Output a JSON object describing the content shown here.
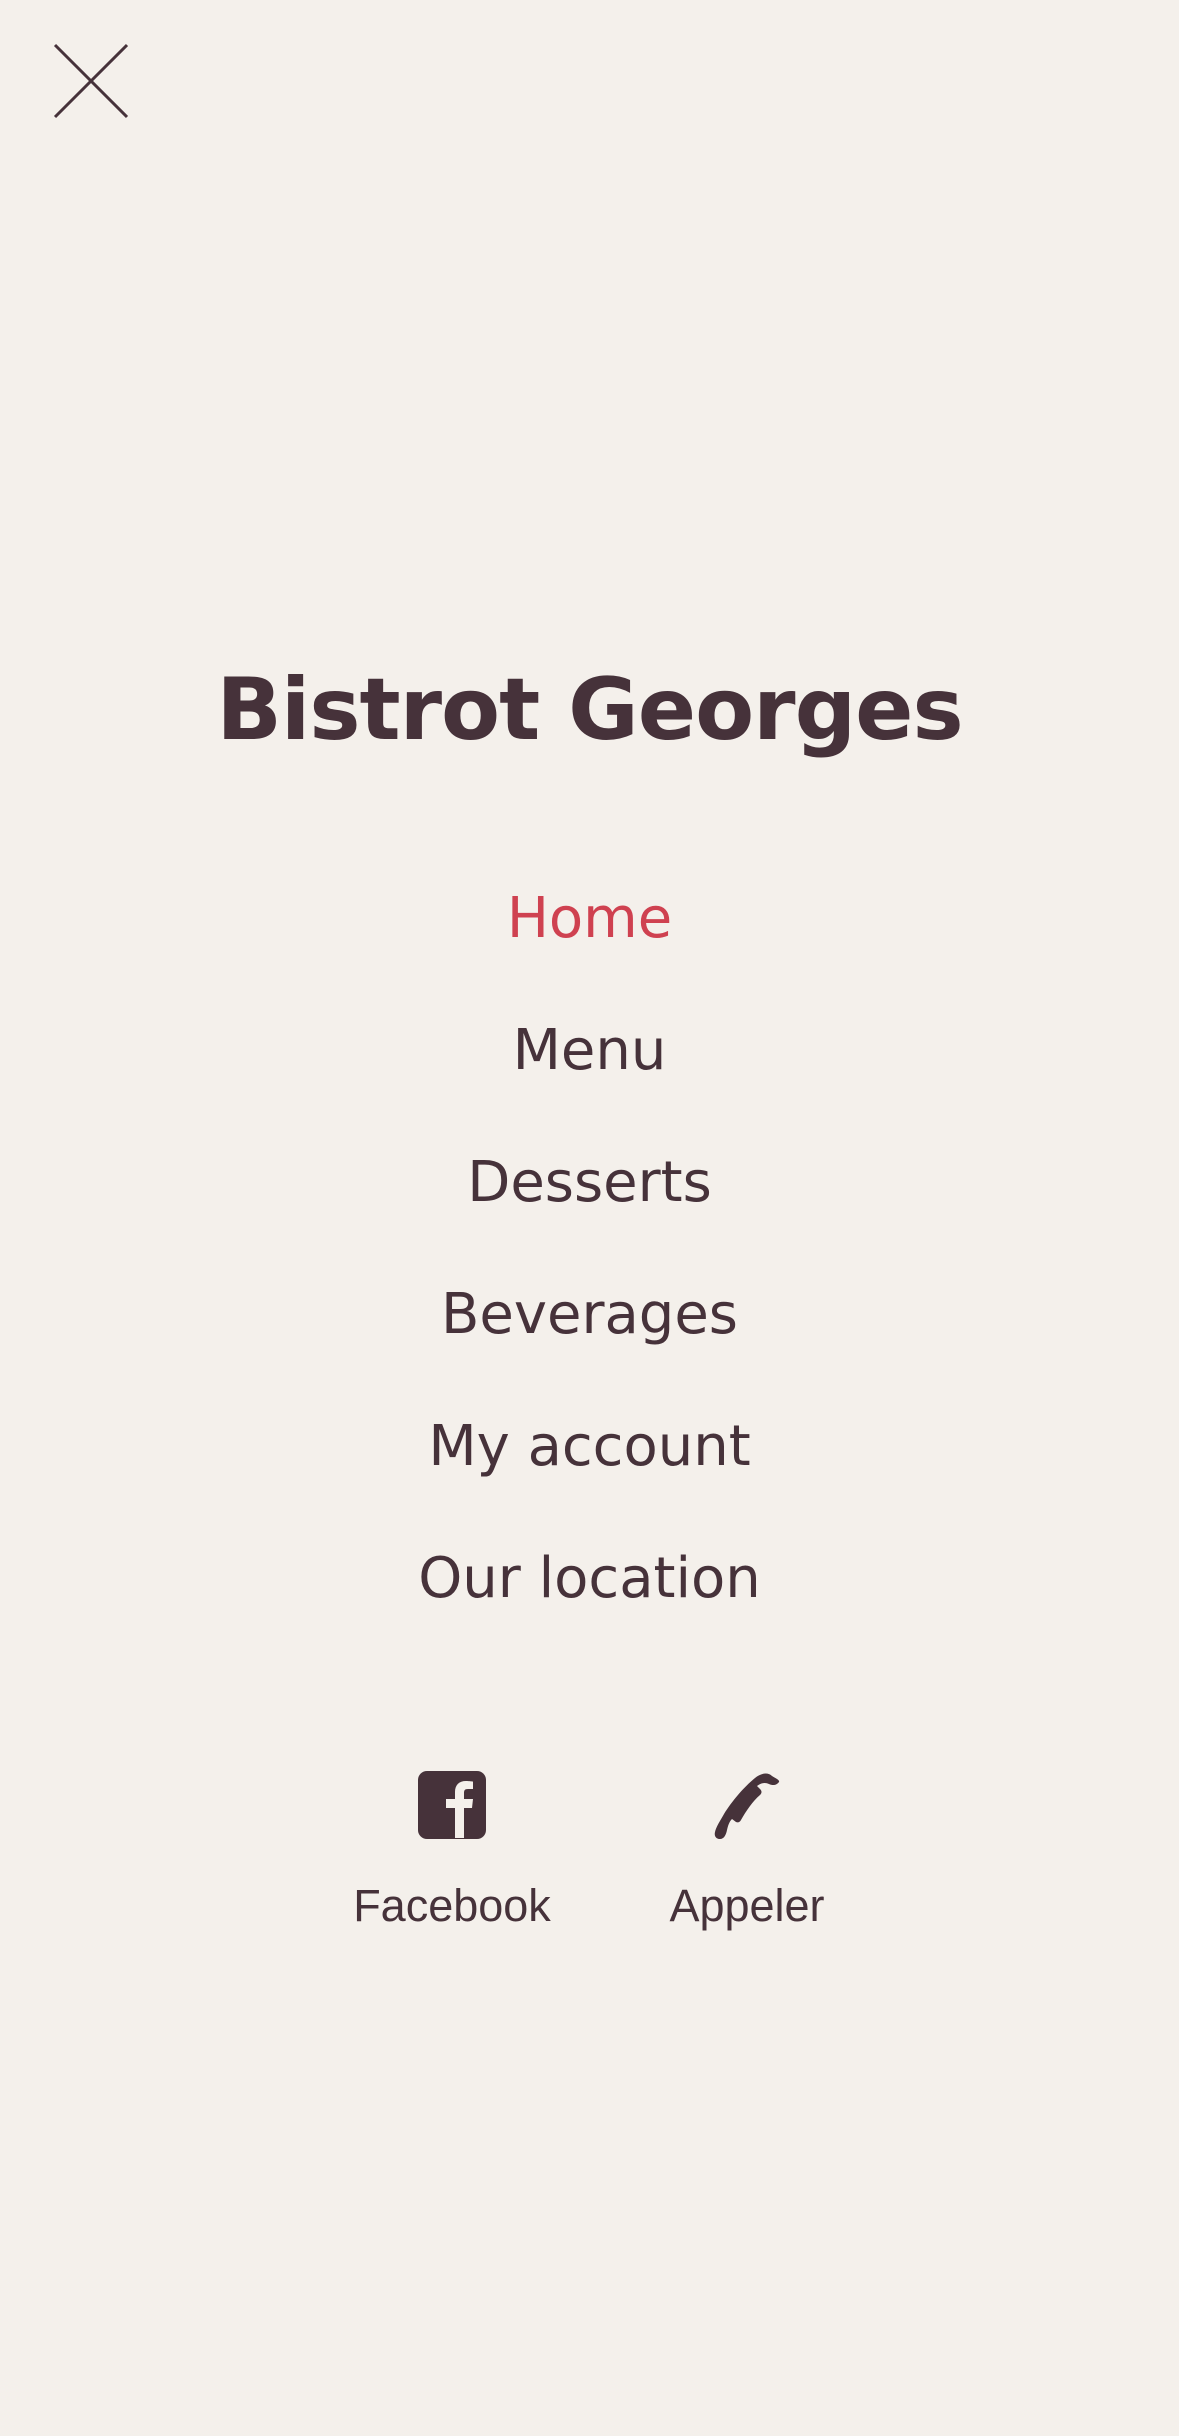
{
  "close": {
    "icon": "close-icon"
  },
  "brand": {
    "title": "Bistrot Georges"
  },
  "nav": {
    "items": [
      {
        "label": "Home",
        "active": true
      },
      {
        "label": "Menu",
        "active": false
      },
      {
        "label": "Desserts",
        "active": false
      },
      {
        "label": "Beverages",
        "active": false
      },
      {
        "label": "My account",
        "active": false
      },
      {
        "label": "Our location",
        "active": false
      }
    ]
  },
  "actions": {
    "facebook": {
      "label": "Facebook",
      "icon": "facebook-icon"
    },
    "call": {
      "label": "Appeler",
      "icon": "phone-icon"
    }
  },
  "colors": {
    "background": "#f4f0eb",
    "text": "#46323a",
    "accent": "#cf4150"
  }
}
